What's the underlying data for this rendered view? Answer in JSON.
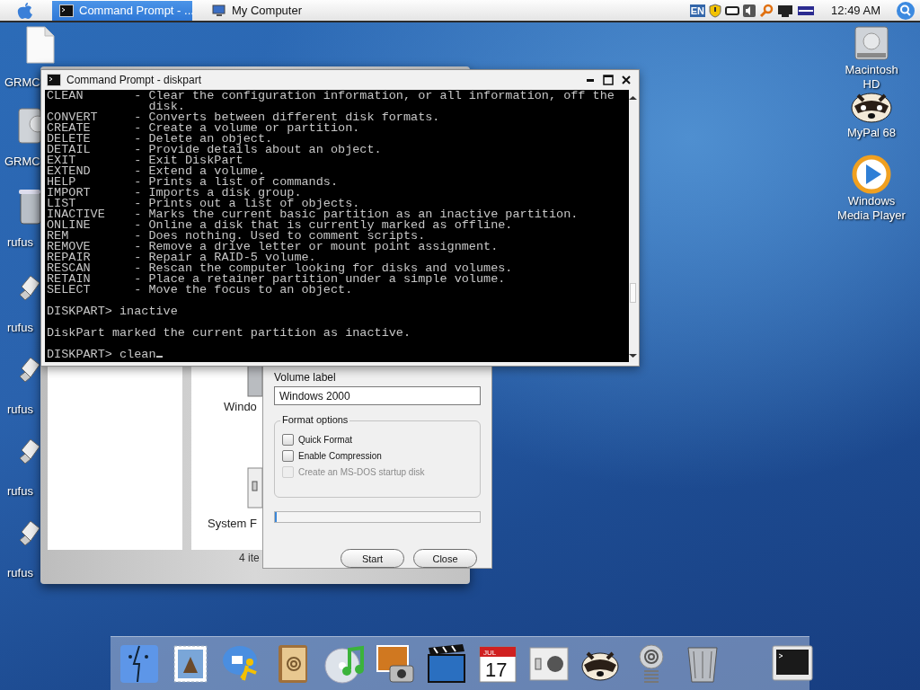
{
  "menubar": {
    "tasks": [
      {
        "title": "Command Prompt - ...",
        "selected": true
      },
      {
        "title": "My Computer",
        "selected": false
      }
    ],
    "language": "EN",
    "clock": "12:49 AM"
  },
  "desktop_left": [
    {
      "label": "GRMC",
      "kind": "file"
    },
    {
      "label": "GRMC",
      "kind": "drive"
    },
    {
      "label": "rufus",
      "kind": "trash"
    },
    {
      "label": "rufus",
      "kind": "usb"
    },
    {
      "label": "rufus",
      "kind": "usb"
    },
    {
      "label": "rufus",
      "kind": "usb"
    },
    {
      "label": "rufus",
      "kind": "usb"
    }
  ],
  "desktop_right": [
    {
      "label": "Macintosh HD",
      "kind": "drive"
    },
    {
      "label": "MyPal 68",
      "kind": "raccoon"
    },
    {
      "label": "Windows Media Player",
      "kind": "media"
    }
  ],
  "my_computer": {
    "items": [
      {
        "label": "Windo",
        "kind": "drive"
      },
      {
        "label": "System F",
        "kind": "switch"
      }
    ],
    "status": "4 ite"
  },
  "format_dialog": {
    "volume_label": "Volume label",
    "volume_value": "Windows 2000",
    "options_title": "Format options",
    "options": [
      {
        "label": "Quick Format",
        "checked": false,
        "disabled": false
      },
      {
        "label": "Enable Compression",
        "checked": false,
        "disabled": false
      },
      {
        "label": "Create an MS-DOS startup disk",
        "checked": false,
        "disabled": true
      }
    ],
    "progress": {
      "level": 0.01
    },
    "buttons": [
      "Start",
      "Close"
    ]
  },
  "console": {
    "title": "Command Prompt - diskpart",
    "separator": "-",
    "commands": [
      {
        "name": "CLEAN",
        "description": "Clear the configuration information, or all information, off the disk."
      },
      {
        "name": "CONVERT",
        "description": "Converts between different disk formats."
      },
      {
        "name": "CREATE",
        "description": "Create a volume or partition."
      },
      {
        "name": "DELETE",
        "description": "Delete an object."
      },
      {
        "name": "DETAIL",
        "description": "Provide details about an object."
      },
      {
        "name": "EXIT",
        "description": "Exit DiskPart"
      },
      {
        "name": "EXTEND",
        "description": "Extend a volume."
      },
      {
        "name": "HELP",
        "description": "Prints a list of commands."
      },
      {
        "name": "IMPORT",
        "description": "Imports a disk group."
      },
      {
        "name": "LIST",
        "description": "Prints out a list of objects."
      },
      {
        "name": "INACTIVE",
        "description": "Marks the current basic partition as an inactive partition."
      },
      {
        "name": "ONLINE",
        "description": "Online a disk that is currently marked as offline."
      },
      {
        "name": "REM",
        "description": "Does nothing. Used to comment scripts."
      },
      {
        "name": "REMOVE",
        "description": "Remove a drive letter or mount point assignment."
      },
      {
        "name": "REPAIR",
        "description": "Repair a RAID-5 volume."
      },
      {
        "name": "RESCAN",
        "description": "Rescan the computer looking for disks and volumes."
      },
      {
        "name": "RETAIN",
        "description": "Place a retainer partition under a simple volume."
      },
      {
        "name": "SELECT",
        "description": "Move the focus to an object."
      }
    ],
    "output": [
      {
        "kind": "blank"
      },
      {
        "kind": "prompt",
        "text": "DISKPART> inactive"
      },
      {
        "kind": "blank"
      },
      {
        "kind": "message",
        "text": "DiskPart marked the current partition as inactive."
      },
      {
        "kind": "blank"
      },
      {
        "kind": "input",
        "text": "DISKPART> clean"
      }
    ]
  },
  "dock": {
    "items": [
      {
        "kind": "finder"
      },
      {
        "kind": "mail"
      },
      {
        "kind": "chat"
      },
      {
        "kind": "contacts"
      },
      {
        "kind": "music"
      },
      {
        "kind": "photos"
      },
      {
        "kind": "movie"
      },
      {
        "kind": "calendar",
        "text": "17",
        "month": "JUL"
      },
      {
        "kind": "preferences"
      },
      {
        "kind": "raccoon"
      },
      {
        "kind": "mailspring"
      },
      {
        "kind": "trash"
      },
      {
        "kind": "terminal"
      }
    ]
  }
}
